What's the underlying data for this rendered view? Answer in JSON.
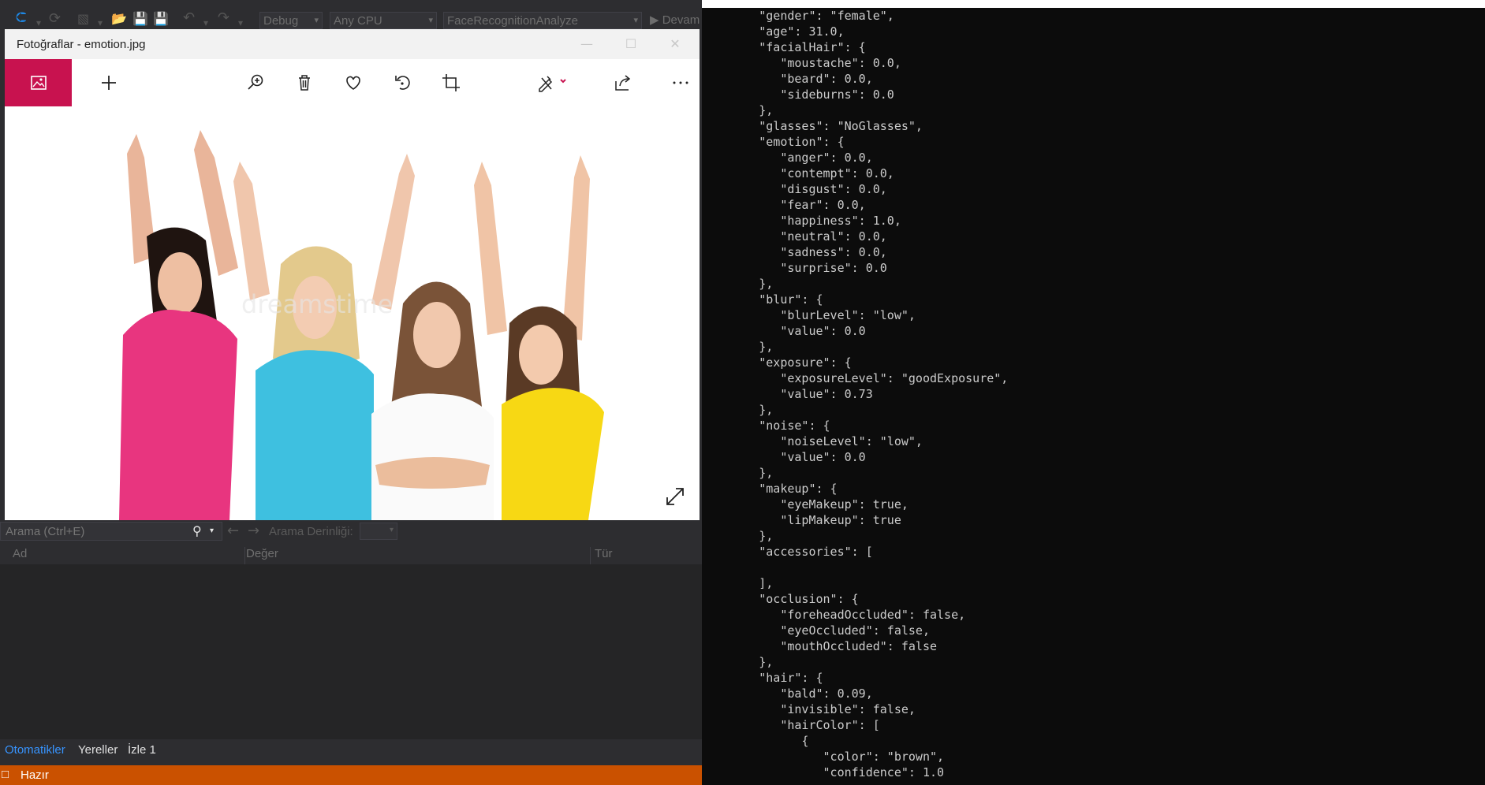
{
  "vs": {
    "toolbar": {
      "config_combo": "Debug",
      "platform_combo": "Any CPU",
      "project_combo": "FaceRecognitionAnalyze",
      "run_label": "Devam"
    },
    "photos": {
      "title": "Fotoğraflar - emotion.jpg",
      "accent_color": "#c8124f"
    },
    "locals": {
      "search_placeholder": "Arama (Ctrl+E)",
      "depth_label": "Arama Derinliği:",
      "col_name": "Ad",
      "col_value": "Değer",
      "col_type": "Tür"
    },
    "tabs": [
      {
        "label": "Otomatikler",
        "active": true
      },
      {
        "label": "Yereller",
        "active": false
      },
      {
        "label": "İzle 1",
        "active": false
      }
    ],
    "status": "Hazır",
    "status_color": "#ca5100"
  },
  "console": {
    "lines": [
      "        \"gender\": \"female\",",
      "        \"age\": 31.0,",
      "        \"facialHair\": {",
      "           \"moustache\": 0.0,",
      "           \"beard\": 0.0,",
      "           \"sideburns\": 0.0",
      "        },",
      "        \"glasses\": \"NoGlasses\",",
      "        \"emotion\": {",
      "           \"anger\": 0.0,",
      "           \"contempt\": 0.0,",
      "           \"disgust\": 0.0,",
      "           \"fear\": 0.0,",
      "           \"happiness\": 1.0,",
      "           \"neutral\": 0.0,",
      "           \"sadness\": 0.0,",
      "           \"surprise\": 0.0",
      "        },",
      "        \"blur\": {",
      "           \"blurLevel\": \"low\",",
      "           \"value\": 0.0",
      "        },",
      "        \"exposure\": {",
      "           \"exposureLevel\": \"goodExposure\",",
      "           \"value\": 0.73",
      "        },",
      "        \"noise\": {",
      "           \"noiseLevel\": \"low\",",
      "           \"value\": 0.0",
      "        },",
      "        \"makeup\": {",
      "           \"eyeMakeup\": true,",
      "           \"lipMakeup\": true",
      "        },",
      "        \"accessories\": [",
      "",
      "        ],",
      "        \"occlusion\": {",
      "           \"foreheadOccluded\": false,",
      "           \"eyeOccluded\": false,",
      "           \"mouthOccluded\": false",
      "        },",
      "        \"hair\": {",
      "           \"bald\": 0.09,",
      "           \"invisible\": false,",
      "           \"hairColor\": [",
      "              {",
      "                 \"color\": \"brown\",",
      "                 \"confidence\": 1.0"
    ]
  },
  "icons": [
    "back-icon",
    "forward-icon",
    "undo-icon",
    "redo-icon",
    "save-icon",
    "photos-icon",
    "add-icon",
    "zoom-icon",
    "delete-icon",
    "heart-icon",
    "rotate-icon",
    "crop-icon",
    "edit-icon",
    "share-icon",
    "more-icon",
    "expand-icon",
    "search-icon",
    "arrow-left-icon",
    "arrow-right-icon"
  ]
}
